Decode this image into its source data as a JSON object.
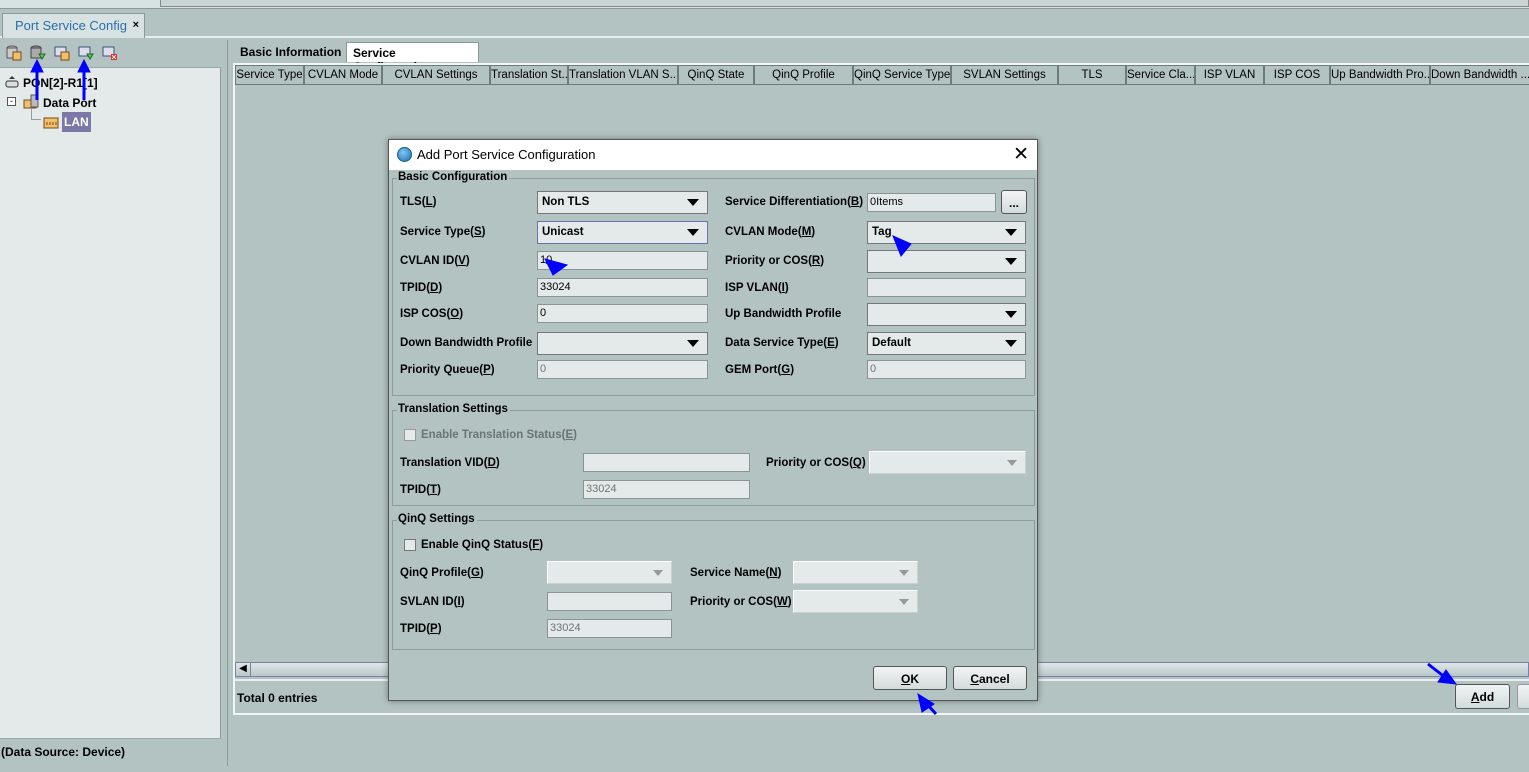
{
  "window": {
    "tab_label": "Port Service Config",
    "tab_close": "×"
  },
  "left_panel": {
    "toolbar": [
      {
        "icon": "database-book-icon"
      },
      {
        "icon": "database-download-icon"
      },
      {
        "icon": "window-book-icon"
      },
      {
        "icon": "window-download-icon"
      },
      {
        "icon": "window-delete-icon"
      }
    ],
    "tree": {
      "root": "PON[2]-R1[1]",
      "child": "Data Port",
      "leaf": "LAN"
    },
    "footer": "(Data Source: Device)"
  },
  "main": {
    "tabs": [
      {
        "label": "Basic Information"
      },
      {
        "label": "Service Configuration",
        "active": true
      }
    ],
    "table": {
      "columns": [
        "Service Type",
        "CVLAN Mode",
        "CVLAN Settings",
        "Translation St...",
        "Translation VLAN S...",
        "QinQ State",
        "QinQ Profile",
        "QinQ Service Type",
        "SVLAN Settings",
        "TLS",
        "Service Cla...",
        "ISP VLAN",
        "ISP COS",
        "Up Bandwidth Pro...",
        "Down Bandwidth ..."
      ],
      "rows": []
    },
    "total": "Total 0 entries",
    "add_button": {
      "label": "dd",
      "key": "A"
    }
  },
  "dialog": {
    "title": "Add Port Service Configuration",
    "basic": {
      "title": "Basic Configuration",
      "tls": {
        "label": "TLS",
        "key": "L",
        "value": "Non TLS"
      },
      "service_diff": {
        "label": "Service Differentiation",
        "key": "B",
        "value": "0Items",
        "button": "..."
      },
      "service_type": {
        "label": "Service Type",
        "key": "S",
        "value": "Unicast"
      },
      "cvlan_mode": {
        "label": "CVLAN Mode",
        "key": "M",
        "value": "Tag"
      },
      "cvlan_id": {
        "label": "CVLAN ID",
        "key": "V",
        "value": "10"
      },
      "priority_cos": {
        "label": "Priority or COS",
        "key": "R",
        "value": ""
      },
      "tpid": {
        "label": "TPID",
        "key": "D",
        "value": "33024"
      },
      "isp_vlan": {
        "label": "ISP VLAN",
        "key": "I",
        "value": ""
      },
      "isp_cos": {
        "label": "ISP COS",
        "key": "O",
        "value": "0"
      },
      "up_bw": {
        "label": "Up Bandwidth Profile",
        "value": ""
      },
      "down_bw": {
        "label": "Down Bandwidth Profile",
        "value": ""
      },
      "data_service_type": {
        "label": "Data Service Type",
        "key": "E",
        "value": "Default"
      },
      "priority_queue": {
        "label": "Priority Queue",
        "key": "P",
        "value": "0"
      },
      "gem_port": {
        "label": "GEM Port",
        "key": "G",
        "value": "0"
      }
    },
    "translation": {
      "title": "Translation Settings",
      "enable": {
        "label": "Enable Translation Status",
        "key": "E",
        "checked": false,
        "disabled": true
      },
      "vid": {
        "label": "Translation VID",
        "key": "D",
        "value": ""
      },
      "priority_cos": {
        "label": "Priority or COS",
        "key": "Q",
        "value": ""
      },
      "tpid": {
        "label": "TPID",
        "key": "T",
        "value": "33024"
      }
    },
    "qinq": {
      "title": "QinQ Settings",
      "enable": {
        "label": "Enable QinQ Status",
        "key": "F",
        "checked": false
      },
      "profile": {
        "label": "QinQ Profile",
        "key": "G",
        "value": ""
      },
      "service_name": {
        "label": "Service Name",
        "key": "N",
        "value": ""
      },
      "svlan_id": {
        "label": "SVLAN ID",
        "key": "I",
        "value": ""
      },
      "priority_cos": {
        "label": "Priority or COS",
        "key": "W",
        "value": ""
      },
      "tpid": {
        "label": "TPID",
        "key": "P",
        "value": "33024"
      }
    },
    "ok": {
      "label": "K",
      "key": "O"
    },
    "cancel": {
      "label": "ancel",
      "key": "C"
    }
  },
  "colors": {
    "background": "#b3c3c2",
    "panel": "#e4eaea",
    "tab_text": "#2a6fa8",
    "annotation_arrow": "#0000ff",
    "selected_leaf": "#7b78a8"
  }
}
